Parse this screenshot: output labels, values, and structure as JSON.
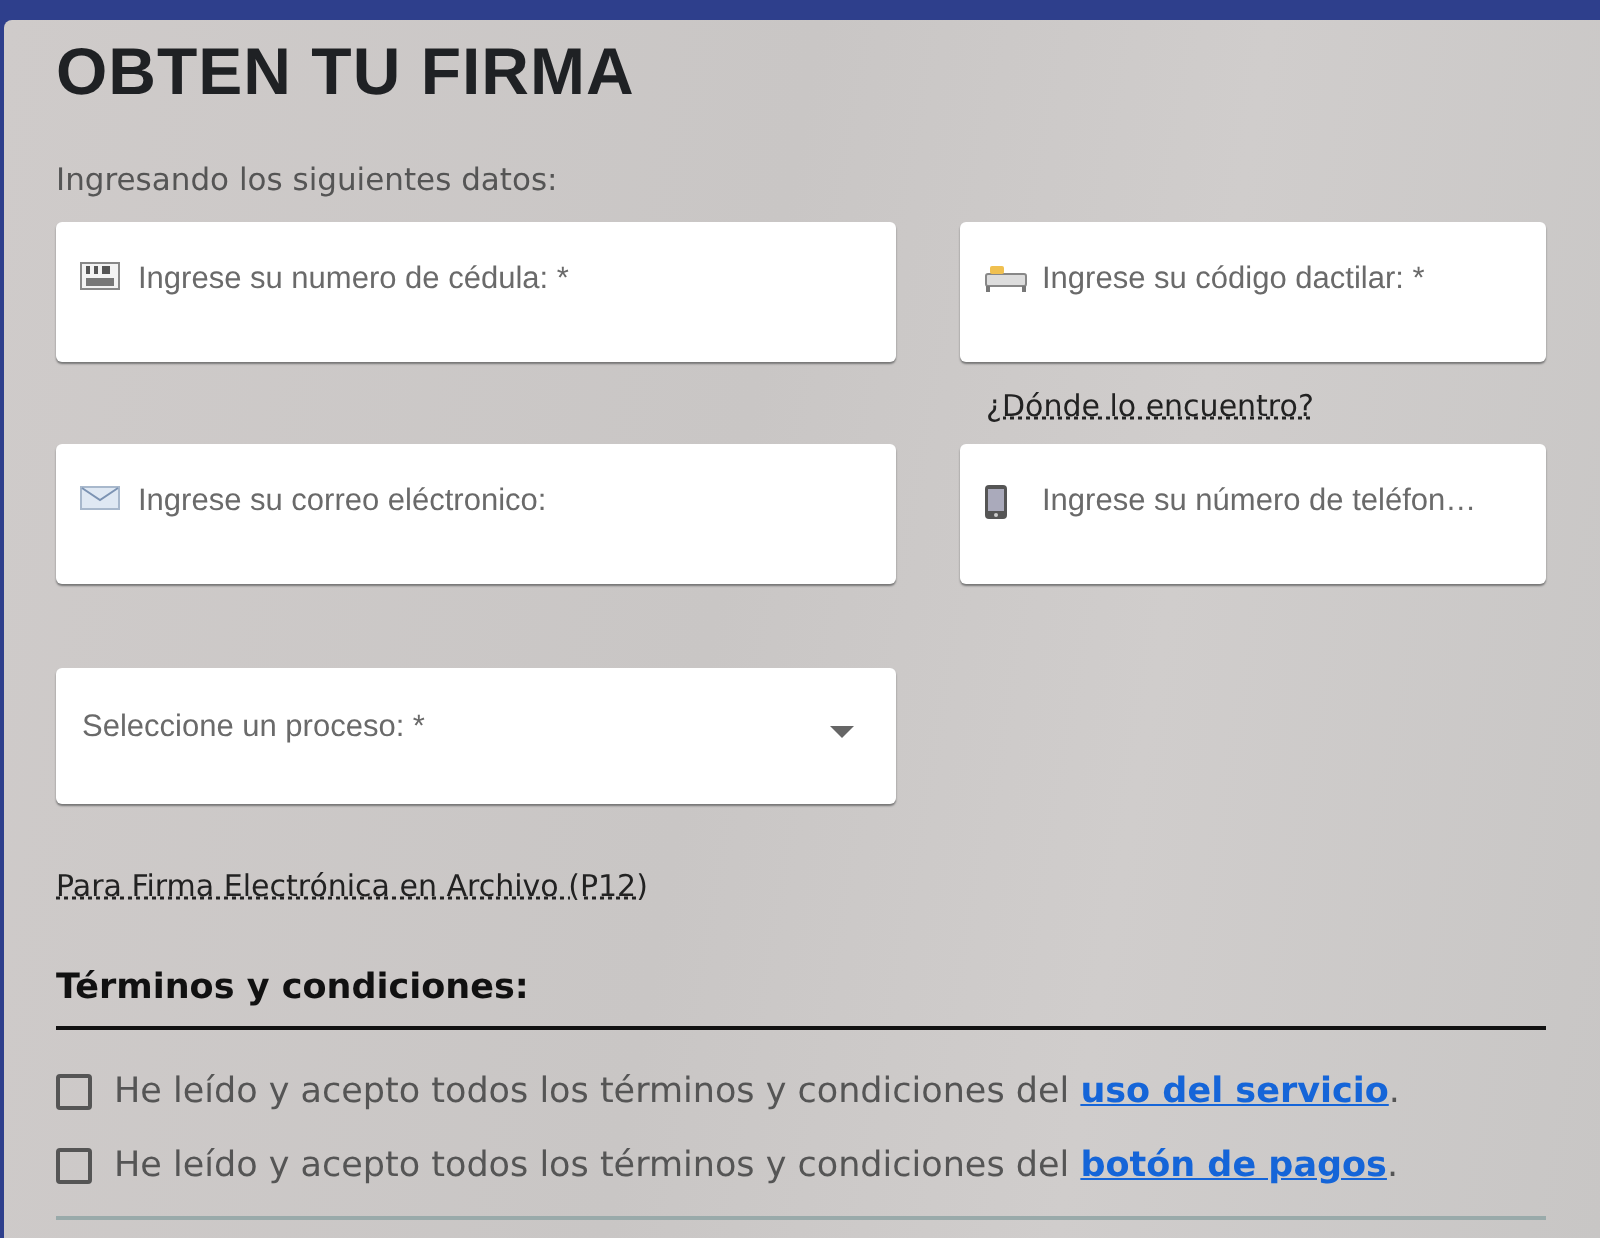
{
  "title": "OBTEN TU FIRMA",
  "subtitle": "Ingresando los siguientes datos:",
  "fields": [
    {
      "kind": "text",
      "placeholder": "Ingrese su numero de cédula: *"
    },
    {
      "kind": "text",
      "placeholder": "Ingrese su código dactilar: *",
      "help": "¿Dónde lo encuentro?"
    },
    {
      "kind": "text",
      "placeholder": "Ingrese su correo eléctronico:"
    },
    {
      "kind": "text",
      "placeholder": "Ingrese su número de teléfon…"
    },
    {
      "kind": "select",
      "placeholder": "Seleccione un proceso: *"
    }
  ],
  "process_note": "Para Firma Electrónica en Archivo (P12)",
  "terms": {
    "heading": "Términos y condiciones:",
    "items": [
      {
        "text": "He leído y acepto todos los términos y condiciones del ",
        "link": "uso del servicio",
        "end": ".",
        "checked": false
      },
      {
        "text": "He leído y acepto todos los términos y condiciones del ",
        "link": "botón de pagos",
        "end": ".",
        "checked": false
      }
    ]
  }
}
